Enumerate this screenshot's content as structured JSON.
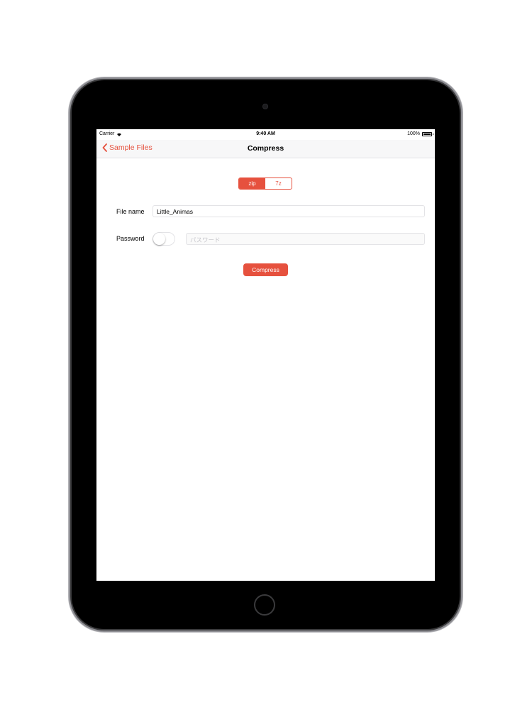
{
  "status_bar": {
    "carrier": "Carrier",
    "time": "9:40 AM",
    "battery": "100%"
  },
  "nav": {
    "back_label": "Sample Files",
    "title": "Compress"
  },
  "format": {
    "options": [
      "zip",
      "7z"
    ],
    "selected": "zip"
  },
  "file_name": {
    "label": "File name",
    "value": "Little_Animas"
  },
  "password": {
    "label": "Password",
    "toggle_on": false,
    "placeholder": "パスワード"
  },
  "compress_button": {
    "label": "Compress"
  },
  "colors": {
    "accent": "#e6513e",
    "device": "#000000"
  }
}
